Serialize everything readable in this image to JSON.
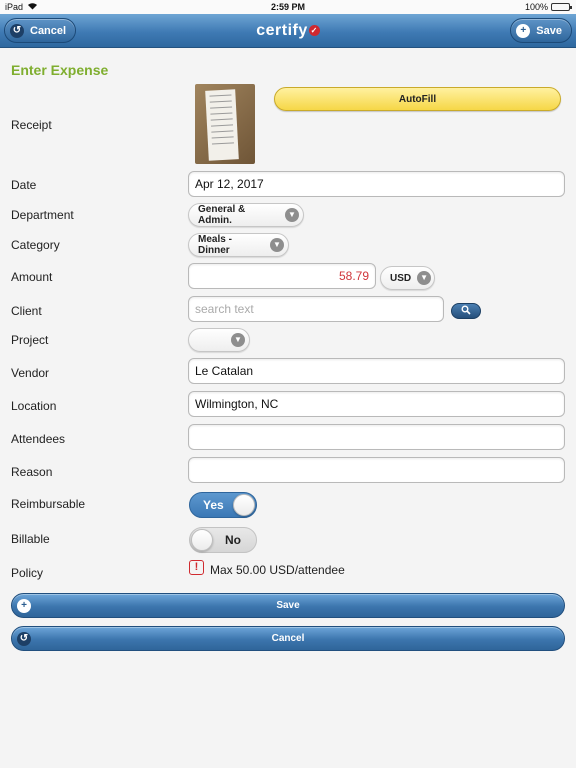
{
  "status_bar": {
    "device": "iPad",
    "time": "2:59 PM",
    "battery": "100%"
  },
  "nav": {
    "cancel_label": "Cancel",
    "brand": "certify",
    "save_label": "Save"
  },
  "form": {
    "heading": "Enter Expense",
    "receipt_label": "Receipt",
    "autofill_label": "AutoFill",
    "date_label": "Date",
    "date_value": "Apr 12, 2017",
    "department_label": "Department",
    "department_value": "General & Admin.",
    "category_label": "Category",
    "category_value": "Meals - Dinner",
    "amount_label": "Amount",
    "amount_value": "58.79",
    "currency_value": "USD",
    "client_label": "Client",
    "client_placeholder": "search text",
    "project_label": "Project",
    "project_value": "",
    "vendor_label": "Vendor",
    "vendor_value": "Le Catalan",
    "location_label": "Location",
    "location_value": "Wilmington, NC",
    "attendees_label": "Attendees",
    "attendees_value": "",
    "reason_label": "Reason",
    "reason_value": "",
    "reimbursable_label": "Reimbursable",
    "reimbursable_value": "Yes",
    "billable_label": "Billable",
    "billable_value": "No",
    "policy_label": "Policy",
    "policy_text": "Max 50.00 USD/attendee"
  },
  "actions": {
    "save_label": "Save",
    "cancel_label": "Cancel"
  },
  "colors": {
    "accent_green": "#7fae2f",
    "nav_blue": "#3f7ab4",
    "warning_red": "#d02a2f",
    "autofill_yellow": "#f6d747"
  }
}
